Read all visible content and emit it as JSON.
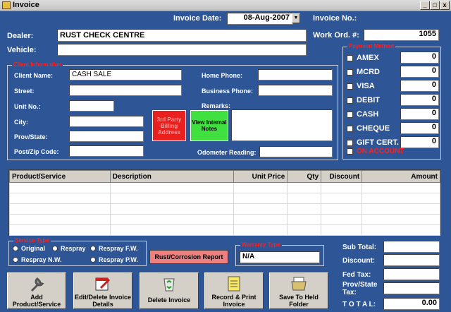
{
  "window": {
    "title": "Invoice",
    "buttons": [
      "_",
      "□",
      "x"
    ]
  },
  "header": {
    "invoice_date_label": "Invoice Date:",
    "invoice_date_value": "08-Aug-2007",
    "invoice_no_label": "Invoice No.:",
    "work_ord_label": "Work Ord. #:",
    "work_ord_value": "1055",
    "dealer_label": "Dealer:",
    "dealer_value": "RUST CHECK CENTRE",
    "vehicle_label": "Vehicle:",
    "vehicle_value": ""
  },
  "client": {
    "group_title": "Client Information",
    "client_name_label": "Client Name:",
    "client_name_value": "CASH SALE",
    "street_label": "Street:",
    "unit_label": "Unit No.:",
    "city_label": "City:",
    "prov_label": "Prov/State:",
    "postal_label": "Post/Zip Code:",
    "home_phone_label": "Home Phone:",
    "business_phone_label": "Business Phone:",
    "remarks_label": "Remarks:",
    "odometer_label": "Odometer Reading:",
    "billing_button": "3rd Party Billing Address",
    "notes_button": "View Internal Notes"
  },
  "payment": {
    "group_title": "Payment Method",
    "methods": [
      {
        "label": "AMEX",
        "value": "0"
      },
      {
        "label": "MCRD",
        "value": "0"
      },
      {
        "label": "VISA",
        "value": "0"
      },
      {
        "label": "DEBIT",
        "value": "0"
      },
      {
        "label": "CASH",
        "value": "0"
      },
      {
        "label": "CHEQUE",
        "value": "0"
      },
      {
        "label": "GIFT CERT.",
        "value": "0"
      }
    ],
    "on_account_label": "ON ACCOUNT"
  },
  "grid": {
    "columns": [
      "Product/Service",
      "Description",
      "Unit Price",
      "Qty",
      "Discount",
      "Amount"
    ]
  },
  "service_type": {
    "group_title": "Service Type",
    "options": [
      "Original",
      "Respray",
      "Respray F.W.",
      "Respray N.W.",
      "Respray P.W."
    ]
  },
  "rust_report_button": "Rust/Corrosion Report",
  "warranty": {
    "group_title": "Warranty Type",
    "value": "N/A"
  },
  "totals": {
    "subtotal_label": "Sub Total:",
    "discount_label": "Discount:",
    "fed_tax_label": "Fed Tax:",
    "prov_tax_label": "Prov/State Tax:",
    "total_label": "T O T A L:",
    "total_value": "0.00"
  },
  "actions": [
    {
      "label": "Add Product/Service",
      "icon": "wrench-icon"
    },
    {
      "label": "Edit/Delete Invoice Details",
      "icon": "calendar-edit-icon"
    },
    {
      "label": "Delete Invoice",
      "icon": "recycle-bin-icon"
    },
    {
      "label": "Record & Print Invoice",
      "icon": "notepad-icon"
    },
    {
      "label": "Save To Held Folder",
      "icon": "folder-icon"
    }
  ],
  "colors": {
    "background": "#2e5596",
    "accent_red": "#e82020",
    "accent_green": "#40e040"
  }
}
